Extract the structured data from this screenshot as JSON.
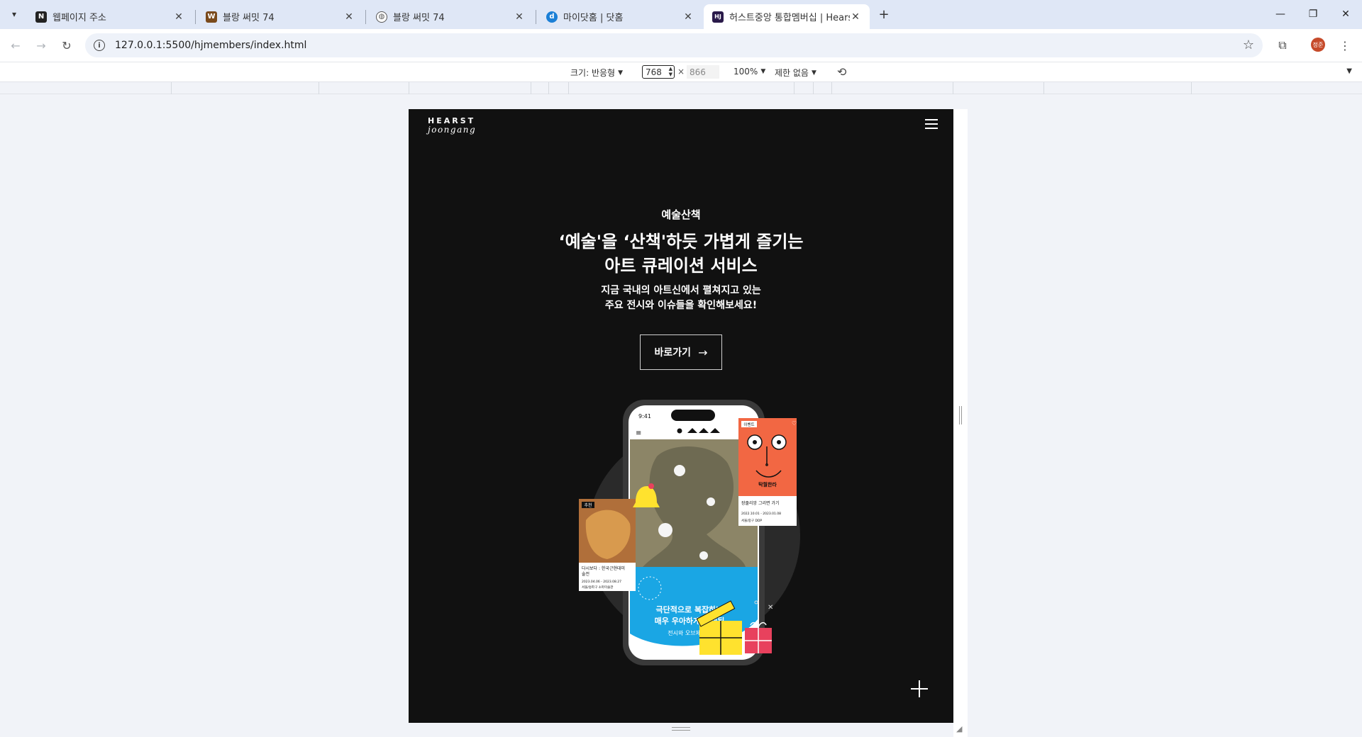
{
  "tabs": [
    {
      "title": "웹페이지 주소",
      "favicon": "N",
      "favicon_color": "#222222"
    },
    {
      "title": "블랑 써밋 74",
      "favicon": "W",
      "favicon_color": "#7a4a1c"
    },
    {
      "title": "블랑 써밋 74",
      "favicon": "globe",
      "favicon_color": "#555555"
    },
    {
      "title": "마이닷홈 | 닷홈",
      "favicon": "d",
      "favicon_color": "#1b7fd6"
    },
    {
      "title": "허스트중앙 통합멤버십 | Hears",
      "favicon": "HJ",
      "favicon_color": "#2a1a4a"
    }
  ],
  "address": {
    "url": "127.0.0.1:5500/hjmembers/index.html"
  },
  "profile": {
    "initials": "정준"
  },
  "devtools": {
    "size_label": "크기: 반응형",
    "width": "768",
    "x": "×",
    "height": "866",
    "zoom": "100%",
    "throttle": "제한 없음"
  },
  "site": {
    "logo_top": "HEARST",
    "logo_bottom": "joongang",
    "eyebrow": "예술산책",
    "headline_line1": "‘예술'을 ‘산책'하듯 가볍게 즐기는",
    "headline_line2": "아트 큐레이션 서비스",
    "desc_line1": "지금 국내의 아트신에서 펼쳐지고 있는",
    "desc_line2": "주요 전시와 이슈들을 확인해보세요!",
    "cta": "바로가기",
    "phone": {
      "time": "9:41",
      "banner_line1": "극단적으로 복잡하나",
      "banner_line2": "매우 우아하게 설계된",
      "banner_line3": "전시와 오브제에서"
    },
    "card_left": {
      "badge": "추천",
      "title_line1": "다시보다 : 한국근현대미",
      "title_line2": "술전",
      "date": "2023.04.06 - 2023.08.27",
      "place": "서울/송파구   소마미술관"
    },
    "card_right": {
      "badge": "이벤트",
      "poster_text": "탁월한라",
      "title": "장줄리앙 그리면 가기",
      "date": "2022.10.01 - 2023.01.08",
      "place": "서울/중구   DDP"
    }
  }
}
